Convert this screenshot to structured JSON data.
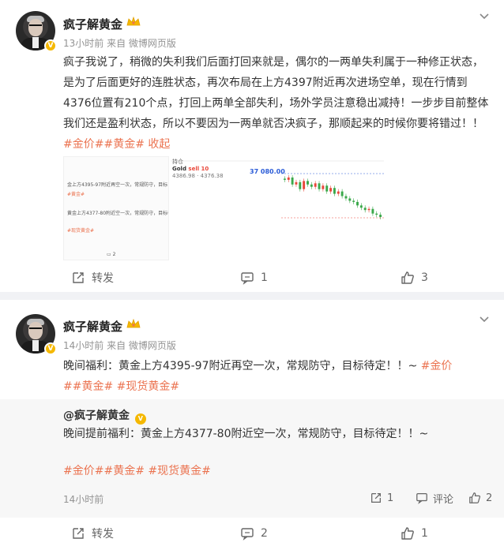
{
  "colors": {
    "accent": "#eb7350",
    "verified": "#f5b800",
    "candle_up": "#e9473a",
    "candle_down": "#3aa84a"
  },
  "posts": [
    {
      "author": "疯子解黄金",
      "meta": "13小时前  来自 微博网页版",
      "text": "疯子我说了，稍微的失利我们后面打回来就是，偶尔的一两单失利属于一种修正状态，是为了后面更好的连胜状态，再次布局在上方4397附近再次进场空单，现在行情到4376位置有210个点，打回上两单全部失利，场外学员注意稳出减持！一步步目前整体我们还是盈利状态，所以不要因为一两单就否决疯子，那顺起来的时候你要将错过！！",
      "tags": "#金价##黄金#",
      "collapse": "收起",
      "thumb1": {
        "line1": "金上方4395-97附近再空一次，常规防守，目标",
        "line2": "#黄金#",
        "line3": "黄金上方4377-80附近空一次，常规防守，目标待",
        "line4": "#现货黄金#",
        "comments": "2"
      },
      "thumb2": {
        "symbol": "Gold",
        "symbol_tag": "sell 10",
        "bid_ask": "4386.98 · 4376.38",
        "price": "37 080.00",
        "header": "持仓"
      },
      "actions": {
        "repost": "转发",
        "comments": "1",
        "likes": "3"
      }
    },
    {
      "author": "疯子解黄金",
      "meta": "14小时前  来自 微博网页版",
      "text": "晚间福利：黄金上方4395-97附近再空一次，常规防守，目标待定！！~ ",
      "tags_inline": "#金价",
      "tags_line2": "##黄金#  #现货黄金#",
      "quote": {
        "author": "@疯子解黄金",
        "text": "晚间提前福利：黄金上方4377-80附近空一次，常规防守，目标待定！！~",
        "tags": "#金价##黄金#  #现货黄金#",
        "time": "14小时前",
        "reposts": "1",
        "comment_label": "评论",
        "likes": "2"
      },
      "actions": {
        "repost": "转发",
        "comments": "2",
        "likes": "1"
      }
    }
  ],
  "chart_data": {
    "type": "candlestick",
    "description_values": [
      37080,
      37090,
      37060,
      37070,
      37040,
      37075,
      37060,
      37050,
      37065,
      37040,
      37055,
      37030,
      37045,
      37020,
      37030,
      37010,
      37000,
      36990,
      36985,
      36970,
      36960,
      36950,
      36955,
      36935,
      36930,
      36920
    ]
  }
}
